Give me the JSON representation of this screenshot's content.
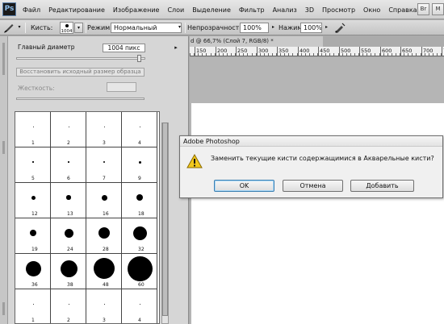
{
  "menubar": {
    "logo": "Ps",
    "items": [
      "Файл",
      "Редактирование",
      "Изображение",
      "Слои",
      "Выделение",
      "Фильтр",
      "Анализ",
      "3D",
      "Просмотр",
      "Окно",
      "Справка"
    ],
    "bridge_label": "Br",
    "mini_label": "M"
  },
  "options": {
    "brush_label": "Кисть:",
    "brush_size": "1004",
    "mode_label": "Режим:",
    "mode_value": "Нормальный",
    "opacity_label": "Непрозрачность:",
    "opacity_value": "100%",
    "pressure_label": "Нажим:",
    "pressure_value": "100%"
  },
  "brush_panel": {
    "diameter_label": "Главный диаметр",
    "diameter_value": "1004 пикс",
    "diameter_fraction": 0.97,
    "restore_label": "Восстановить исходный размер образца",
    "hardness_label": "Жесткость:",
    "brushes": [
      {
        "num": "1"
      },
      {
        "num": "2"
      },
      {
        "num": "3"
      },
      {
        "num": "4"
      },
      {
        "num": "5"
      },
      {
        "num": "6"
      },
      {
        "num": "7"
      },
      {
        "num": "9"
      },
      {
        "num": "12"
      },
      {
        "num": "13"
      },
      {
        "num": "16"
      },
      {
        "num": "18"
      },
      {
        "num": "19"
      },
      {
        "num": "24"
      },
      {
        "num": "28"
      },
      {
        "num": "32"
      },
      {
        "num": "36"
      },
      {
        "num": "38"
      },
      {
        "num": "48"
      },
      {
        "num": "60"
      },
      {
        "num": "1"
      },
      {
        "num": "2"
      },
      {
        "num": "3"
      },
      {
        "num": "4"
      }
    ]
  },
  "document": {
    "tab_title": "d @ 66,7% (Слой 7, RGB/8) *",
    "ruler_labels": [
      "150",
      "200",
      "250",
      "300",
      "350",
      "400",
      "450",
      "500",
      "550",
      "600",
      "650",
      "700",
      "750"
    ]
  },
  "dialog": {
    "title": "Adobe Photoshop",
    "message": "Заменить текущие кисти содержащимися в Акварельные кисти?",
    "ok_label": "OK",
    "cancel_label": "Отмена",
    "append_label": "Добавить",
    "icon": "warning-icon"
  },
  "colors": {
    "warning": "#f2c81c",
    "accent": "#3c7fb1"
  }
}
